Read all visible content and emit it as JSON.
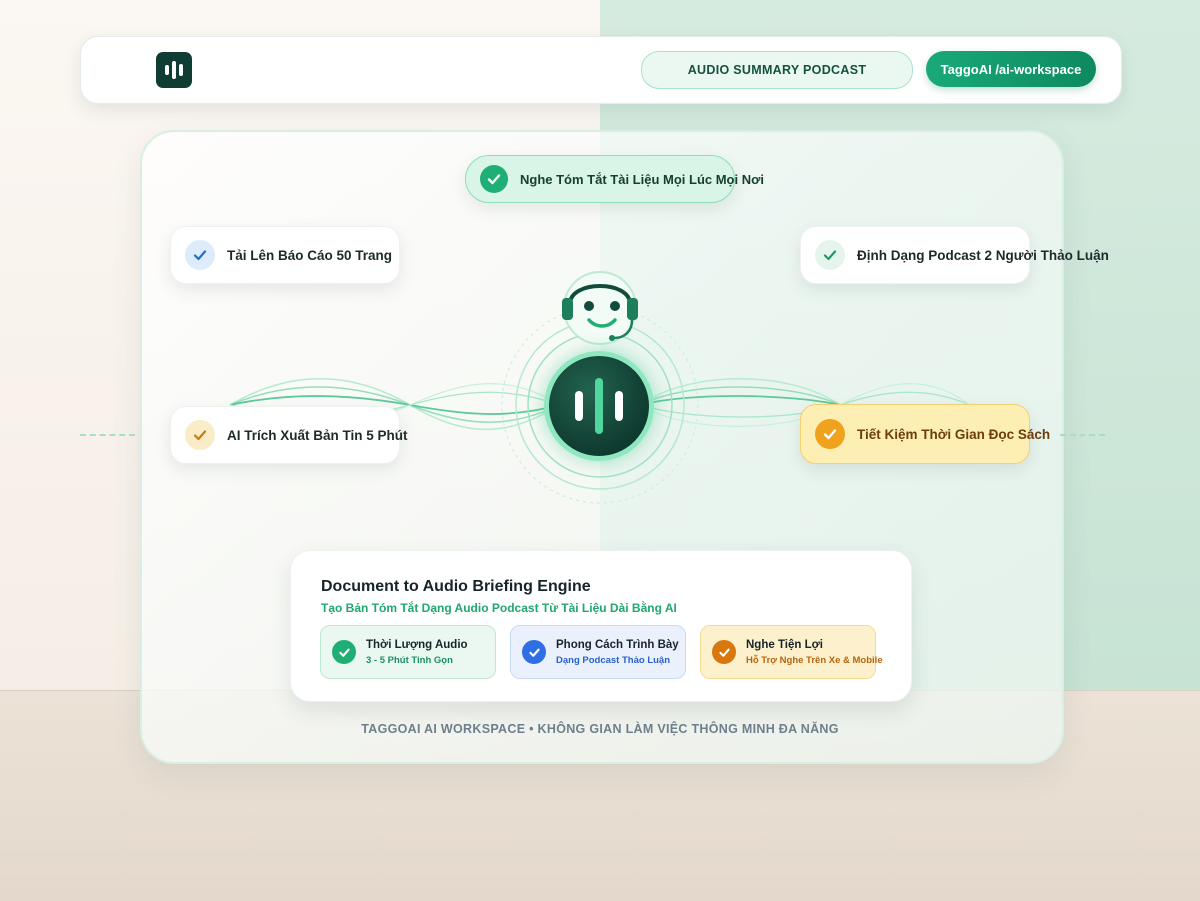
{
  "header": {
    "audio_pill": "AUDIO SUMMARY PODCAST",
    "workspace_button": "TaggoAI /ai-workspace"
  },
  "chips": {
    "top": "Nghe Tóm Tắt Tài Liệu Mọi Lúc Mọi Nơi",
    "upload": "Tải Lên Báo Cáo 50 Trang",
    "format": "Định Dạng Podcast 2 Người Thảo Luận",
    "extract": "AI Trích Xuất Bản Tin 5 Phút",
    "save_time": "Tiết Kiệm Thời Gian Đọc Sách"
  },
  "engine": {
    "title": "Document to Audio Briefing Engine",
    "subtitle": "Tạo Bản Tóm Tắt Dạng Audio Podcast Từ Tài Liệu Dài Bằng AI",
    "features": [
      {
        "title": "Thời Lượng Audio",
        "sub": "3 - 5 Phút Tinh Gọn"
      },
      {
        "title": "Phong Cách Trình Bày",
        "sub": "Dạng Podcast Thảo Luận"
      },
      {
        "title": "Nghe Tiện Lợi",
        "sub": "Hỗ Trợ Nghe Trên Xe & Mobile"
      }
    ]
  },
  "footer": "TAGGOAI AI WORKSPACE • KHÔNG GIAN LÀM VIỆC THÔNG MINH ĐA NĂNG",
  "colors": {
    "brand_dark": "#0f3d33",
    "accent_green": "#1aa979",
    "orange": "#f0a21c",
    "blue": "#2f6fe3"
  },
  "icons": [
    "logo-waveform-icon",
    "check-icon",
    "robot-headset-icon",
    "audio-orb-icon",
    "sound-wave-icon"
  ]
}
